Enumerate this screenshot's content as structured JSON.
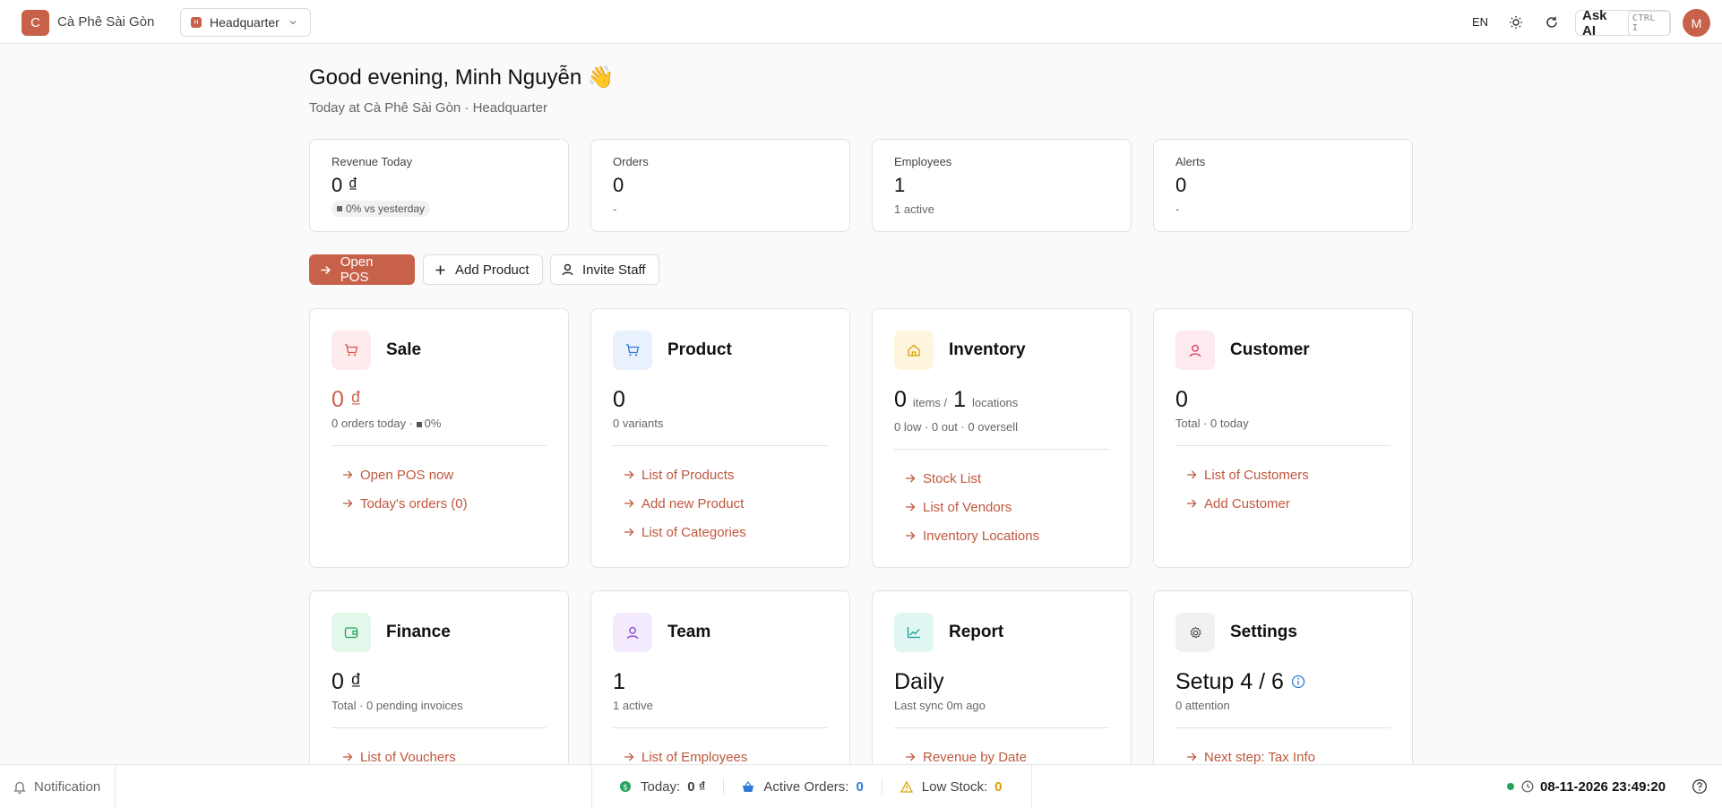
{
  "topbar": {
    "brand_initial": "C",
    "brand_name": "Cà Phê Sài Gòn",
    "location_badge": "H",
    "location": "Headquarter",
    "language": "EN",
    "ask_ai_label": "Ask AI",
    "ask_ai_shortcut": "CTRL I",
    "avatar_initial": "M"
  },
  "greeting": {
    "title": "Good evening, Minh Nguyễn 👋",
    "subtitle": "Today at Cà Phê Sài Gòn · Headquarter"
  },
  "stats": [
    {
      "label": "Revenue Today",
      "value": "0 ₫",
      "sub": "0% vs yesterday"
    },
    {
      "label": "Orders",
      "value": "0",
      "sub": "-"
    },
    {
      "label": "Employees",
      "value": "1",
      "sub": "1 active"
    },
    {
      "label": "Alerts",
      "value": "0",
      "sub": "-"
    }
  ],
  "actions": {
    "open_pos": "Open POS",
    "add_product": "Add Product",
    "invite_staff": "Invite Staff"
  },
  "modules": {
    "sale": {
      "title": "Sale",
      "value": "0 ₫",
      "sub_prefix": "0 orders today · ",
      "sub_suffix": "0%",
      "links": [
        "Open POS now",
        "Today's orders (0)"
      ]
    },
    "product": {
      "title": "Product",
      "value": "0",
      "sub": "0 variants",
      "links": [
        "List of Products",
        "Add new Product",
        "List of Categories"
      ]
    },
    "inventory": {
      "title": "Inventory",
      "items_value": "0",
      "items_unit": "items /",
      "locations_value": "1",
      "locations_unit": "locations",
      "sub": "0 low · 0 out · 0 oversell",
      "links": [
        "Stock List",
        "List of Vendors",
        "Inventory Locations"
      ]
    },
    "customer": {
      "title": "Customer",
      "value": "0",
      "sub": "Total · 0 today",
      "links": [
        "List of Customers",
        "Add Customer"
      ]
    },
    "finance": {
      "title": "Finance",
      "value": "0 ₫",
      "sub": "Total · 0 pending invoices",
      "links": [
        "List of Vouchers"
      ]
    },
    "team": {
      "title": "Team",
      "value": "1",
      "sub": "1 active",
      "links": [
        "List of Employees"
      ]
    },
    "report": {
      "title": "Report",
      "value": "Daily",
      "sub": "Last sync 0m ago",
      "links": [
        "Revenue by Date"
      ]
    },
    "settings": {
      "title": "Settings",
      "value": "Setup 4 / 6",
      "sub": "0 attention",
      "links": [
        "Next step: Tax Info"
      ]
    }
  },
  "bottombar": {
    "notification": "Notification",
    "today_label": "Today:",
    "today_value": "0 ₫",
    "active_orders_label": "Active Orders:",
    "active_orders_value": "0",
    "low_stock_label": "Low Stock:",
    "low_stock_value": "0",
    "datetime": "08-11-2026 23:49:20"
  },
  "colors": {
    "accent": "#c8614a",
    "link": "#c0573d",
    "blue_value": "#2f7bd6",
    "amber_value": "#d9a100",
    "online": "#22a55a"
  },
  "icons": [
    "arrow-right-icon",
    "plus-icon",
    "user-icon",
    "cart-icon",
    "home-icon",
    "wallet-icon",
    "chart-icon",
    "gear-icon",
    "bell-icon",
    "clock-icon",
    "sun-icon",
    "refresh-icon",
    "help-icon",
    "info-icon",
    "basket-icon",
    "warning-icon",
    "dollar-icon",
    "chevron-down-icon"
  ]
}
